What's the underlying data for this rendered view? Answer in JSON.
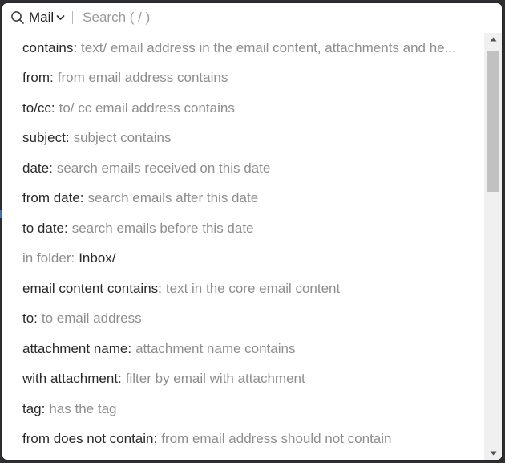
{
  "search": {
    "scope_label": "Mail",
    "placeholder": "Search ( / )",
    "icon": "search-icon",
    "scope_icon": "chevron-down-icon"
  },
  "suggestions": [
    {
      "key": "contains:",
      "desc": "text/ email address in the email content, attachments and he..."
    },
    {
      "key": "from:",
      "desc": "from email address contains"
    },
    {
      "key": "to/cc:",
      "desc": "to/ cc email address contains"
    },
    {
      "key": "subject:",
      "desc": "subject contains"
    },
    {
      "key": "date:",
      "desc": "search emails received on this date"
    },
    {
      "key": "from date:",
      "desc": "search emails after this date"
    },
    {
      "key": "to date:",
      "desc": "search emails before this date"
    },
    {
      "key": "in folder:",
      "desc": "Inbox/"
    },
    {
      "key": "email content contains:",
      "desc": "text in the core email content"
    },
    {
      "key": "to:",
      "desc": "to email address"
    },
    {
      "key": "attachment name:",
      "desc": "attachment name contains"
    },
    {
      "key": "with attachment:",
      "desc": "filter by email with attachment"
    },
    {
      "key": "tag:",
      "desc": "has the tag"
    },
    {
      "key": "from does not contain:",
      "desc": "from email address should not contain"
    }
  ],
  "scrollbar": {
    "up_icon": "scroll-up-arrow-icon",
    "down_icon": "scroll-down-arrow-icon"
  },
  "colors": {
    "key_text": "#2a2a2a",
    "desc_text": "#8e8e8e",
    "scrollbar_track": "#f0f0f0",
    "scrollbar_thumb": "#c1c1c1",
    "background": "#2f2f33"
  }
}
